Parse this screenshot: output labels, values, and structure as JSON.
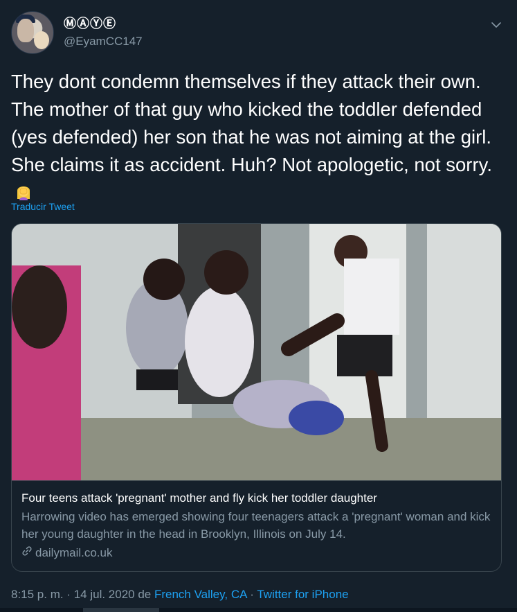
{
  "user": {
    "display_name": "ⓂⒶⓎⒺ",
    "handle": "@EyamCC147"
  },
  "tweet": {
    "text": "They dont condemn themselves if they attack their own. The mother of that guy who kicked the toddler defended (yes defended) her son that he was not aiming at the girl. She claims it as accident. Huh? Not apologetic, not sorry.",
    "emoji_icon": "woman-facepalming-icon",
    "translate_label": "Traducir Tweet"
  },
  "card": {
    "title": "Four teens attack 'pregnant' mother and fly kick her toddler daughter",
    "description": "Harrowing video has emerged showing four teenagers attack a 'pregnant' woman and kick her young daughter in the head in Brooklyn, Illinois on July 14.",
    "domain": "dailymail.co.uk"
  },
  "meta": {
    "timestamp": "8:15 p. m. · 14 jul. 2020",
    "from_label": " de ",
    "location": "French Valley, CA",
    "separator": " · ",
    "source": "Twitter for iPhone"
  },
  "colors": {
    "background": "#15202b",
    "text": "#ffffff",
    "secondary_text": "#8899a6",
    "accent": "#1da1f2",
    "border": "#38444d"
  }
}
